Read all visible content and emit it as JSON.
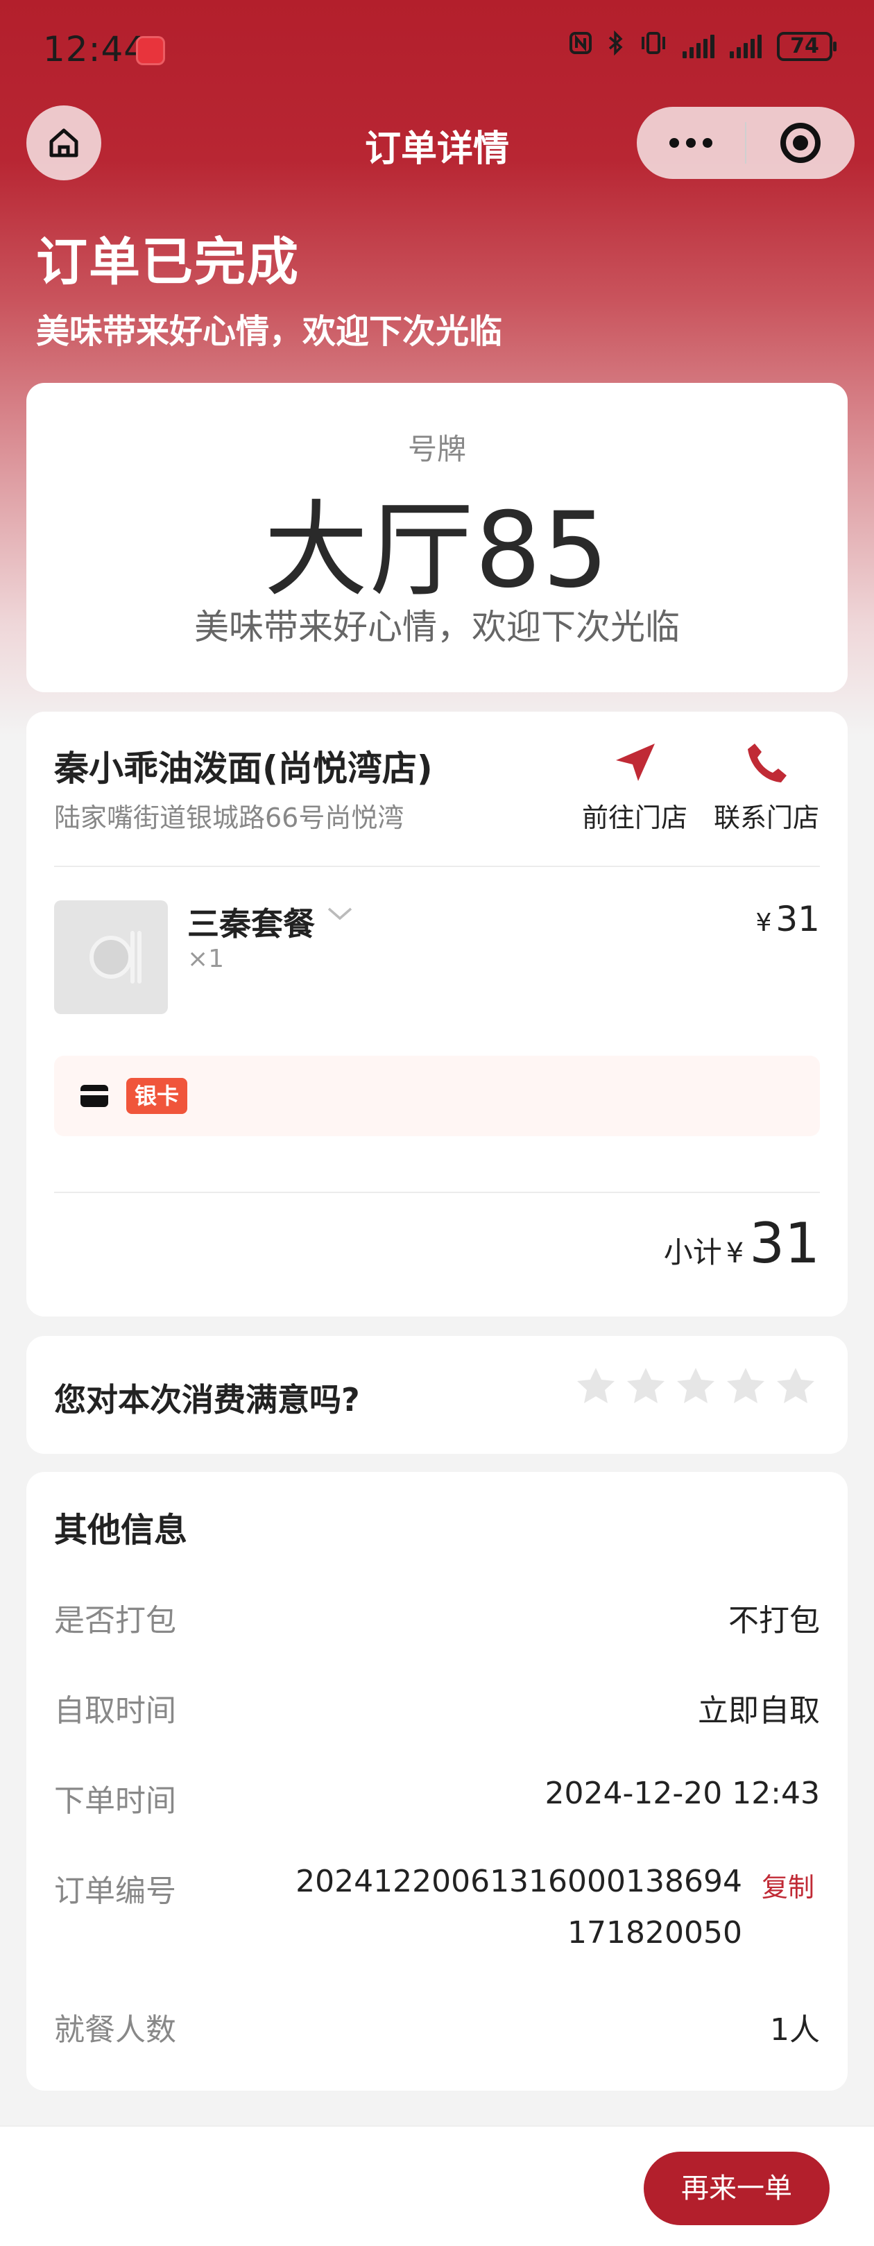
{
  "status_bar": {
    "time": "12:44",
    "battery": "74"
  },
  "nav": {
    "title": "订单详情"
  },
  "hero": {
    "title": "订单已完成",
    "subtitle": "美味带来好心情，欢迎下次光临"
  },
  "pickup": {
    "label": "号牌",
    "number": "大厅85",
    "note": "美味带来好心情，欢迎下次光临"
  },
  "store": {
    "name": "秦小乖油泼面(尚悦湾店)",
    "address": "陆家嘴街道银城路66号尚悦湾",
    "go_label": "前往门店",
    "call_label": "联系门店"
  },
  "item": {
    "name": "三秦套餐",
    "qty": "×1",
    "currency": "¥",
    "price": "31"
  },
  "payment": {
    "tag": "银卡"
  },
  "subtotal": {
    "label": "小计",
    "currency": "¥",
    "value": "31"
  },
  "rating": {
    "question": "您对本次消费满意吗?",
    "stars": 5,
    "selected": 0
  },
  "info": {
    "title": "其他信息",
    "rows": [
      {
        "label": "是否打包",
        "value": "不打包"
      },
      {
        "label": "自取时间",
        "value": "立即自取"
      },
      {
        "label": "下单时间",
        "value": "2024-12-20 12:43"
      },
      {
        "label": "订单编号",
        "value": "2024122006131600013869417182005​0",
        "copy": "复制"
      },
      {
        "label": "就餐人数",
        "value": "1人"
      }
    ]
  },
  "bottom": {
    "reorder_label": "再来一单"
  },
  "colors": {
    "brand": "#b31f2c",
    "tag": "#f0553b",
    "star": "#e6e6e6"
  }
}
